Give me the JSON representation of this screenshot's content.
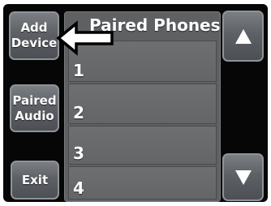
{
  "left_buttons": {
    "add_device": {
      "line1": "Add",
      "line2": "Device"
    },
    "paired_audio": {
      "line1": "Paired",
      "line2": "Audio"
    },
    "exit": {
      "label": "Exit"
    }
  },
  "list": {
    "title": "Paired Phones",
    "rows": [
      {
        "number": "1"
      },
      {
        "number": "2"
      },
      {
        "number": "3"
      },
      {
        "number": "4"
      }
    ]
  },
  "scroll_buttons": {
    "up_icon": "triangle-up-icon",
    "down_icon": "triangle-down-icon"
  },
  "annotation": {
    "arrow_icon": "arrow-left-icon"
  },
  "colors": {
    "screen_background": "#060606",
    "button_face": "#5d6166",
    "list_background": "#5f6062"
  }
}
